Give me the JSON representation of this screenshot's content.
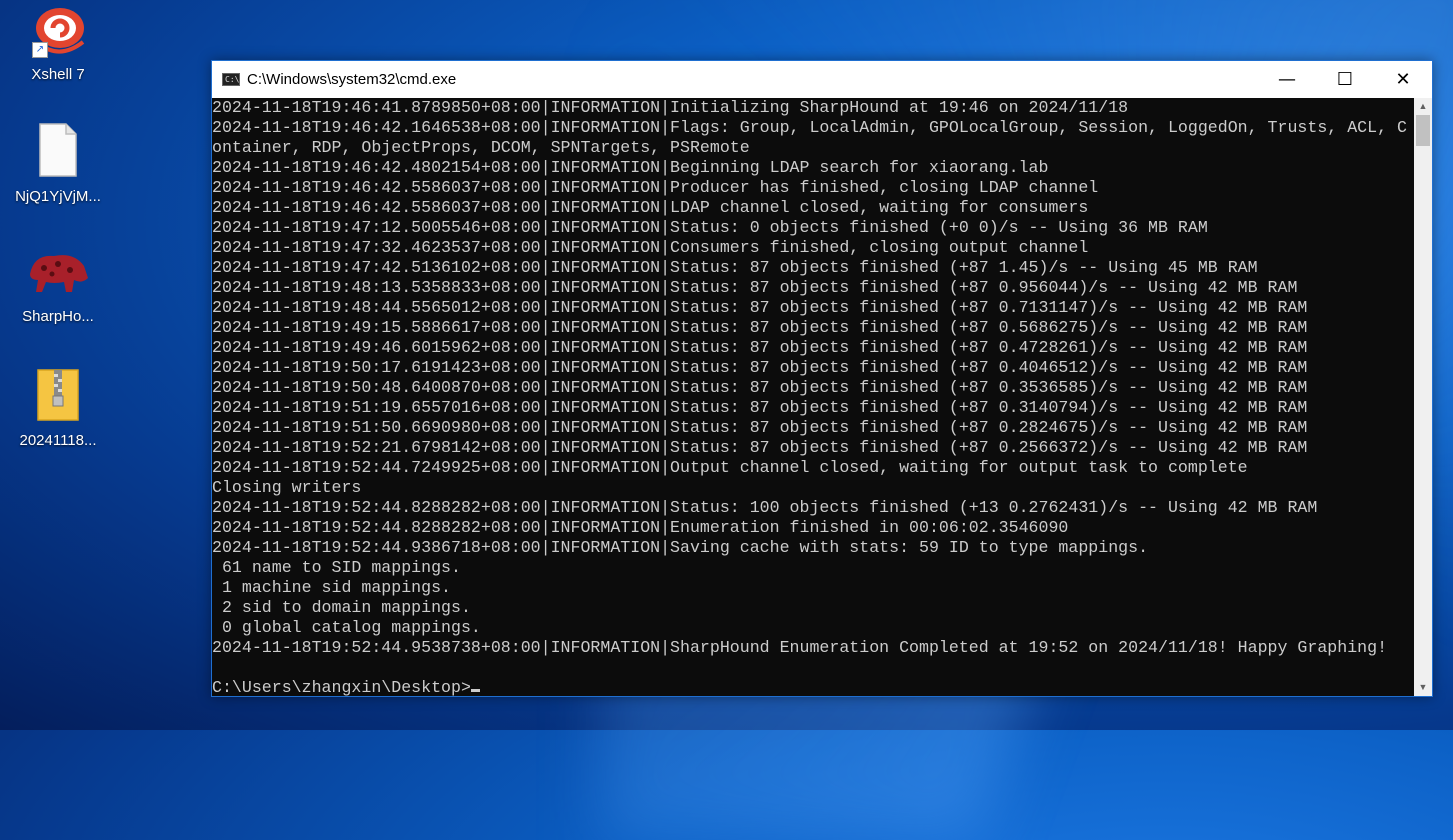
{
  "desktop": {
    "icons": [
      {
        "label": "Xshell 7",
        "icon": "xshell-icon"
      },
      {
        "label": "NjQ1YjVjM...",
        "icon": "file-icon"
      },
      {
        "label": "SharpHo...",
        "icon": "sharphound-icon"
      },
      {
        "label": "20241118...",
        "icon": "zip-folder-icon"
      }
    ]
  },
  "window": {
    "title": "C:\\Windows\\system32\\cmd.exe",
    "controls": {
      "minimize": "—",
      "maximize": "☐",
      "close": "✕"
    }
  },
  "console": {
    "lines": [
      "2024-11-18T19:46:41.8789850+08:00|INFORMATION|Initializing SharpHound at 19:46 on 2024/11/18",
      "2024-11-18T19:46:42.1646538+08:00|INFORMATION|Flags: Group, LocalAdmin, GPOLocalGroup, Session, LoggedOn, Trusts, ACL, C",
      "ontainer, RDP, ObjectProps, DCOM, SPNTargets, PSRemote",
      "2024-11-18T19:46:42.4802154+08:00|INFORMATION|Beginning LDAP search for xiaorang.lab",
      "2024-11-18T19:46:42.5586037+08:00|INFORMATION|Producer has finished, closing LDAP channel",
      "2024-11-18T19:46:42.5586037+08:00|INFORMATION|LDAP channel closed, waiting for consumers",
      "2024-11-18T19:47:12.5005546+08:00|INFORMATION|Status: 0 objects finished (+0 0)/s -- Using 36 MB RAM",
      "2024-11-18T19:47:32.4623537+08:00|INFORMATION|Consumers finished, closing output channel",
      "2024-11-18T19:47:42.5136102+08:00|INFORMATION|Status: 87 objects finished (+87 1.45)/s -- Using 45 MB RAM",
      "2024-11-18T19:48:13.5358833+08:00|INFORMATION|Status: 87 objects finished (+87 0.956044)/s -- Using 42 MB RAM",
      "2024-11-18T19:48:44.5565012+08:00|INFORMATION|Status: 87 objects finished (+87 0.7131147)/s -- Using 42 MB RAM",
      "2024-11-18T19:49:15.5886617+08:00|INFORMATION|Status: 87 objects finished (+87 0.5686275)/s -- Using 42 MB RAM",
      "2024-11-18T19:49:46.6015962+08:00|INFORMATION|Status: 87 objects finished (+87 0.4728261)/s -- Using 42 MB RAM",
      "2024-11-18T19:50:17.6191423+08:00|INFORMATION|Status: 87 objects finished (+87 0.4046512)/s -- Using 42 MB RAM",
      "2024-11-18T19:50:48.6400870+08:00|INFORMATION|Status: 87 objects finished (+87 0.3536585)/s -- Using 42 MB RAM",
      "2024-11-18T19:51:19.6557016+08:00|INFORMATION|Status: 87 objects finished (+87 0.3140794)/s -- Using 42 MB RAM",
      "2024-11-18T19:51:50.6690980+08:00|INFORMATION|Status: 87 objects finished (+87 0.2824675)/s -- Using 42 MB RAM",
      "2024-11-18T19:52:21.6798142+08:00|INFORMATION|Status: 87 objects finished (+87 0.2566372)/s -- Using 42 MB RAM",
      "2024-11-18T19:52:44.7249925+08:00|INFORMATION|Output channel closed, waiting for output task to complete",
      "Closing writers",
      "2024-11-18T19:52:44.8288282+08:00|INFORMATION|Status: 100 objects finished (+13 0.2762431)/s -- Using 42 MB RAM",
      "2024-11-18T19:52:44.8288282+08:00|INFORMATION|Enumeration finished in 00:06:02.3546090",
      "2024-11-18T19:52:44.9386718+08:00|INFORMATION|Saving cache with stats: 59 ID to type mappings.",
      " 61 name to SID mappings.",
      " 1 machine sid mappings.",
      " 2 sid to domain mappings.",
      " 0 global catalog mappings.",
      "2024-11-18T19:52:44.9538738+08:00|INFORMATION|SharpHound Enumeration Completed at 19:52 on 2024/11/18! Happy Graphing!",
      ""
    ],
    "prompt": "C:\\Users\\zhangxin\\Desktop>"
  },
  "colors": {
    "console_bg": "#0c0c0c",
    "console_fg": "#cccccc",
    "window_border": "#1f6fd0"
  }
}
